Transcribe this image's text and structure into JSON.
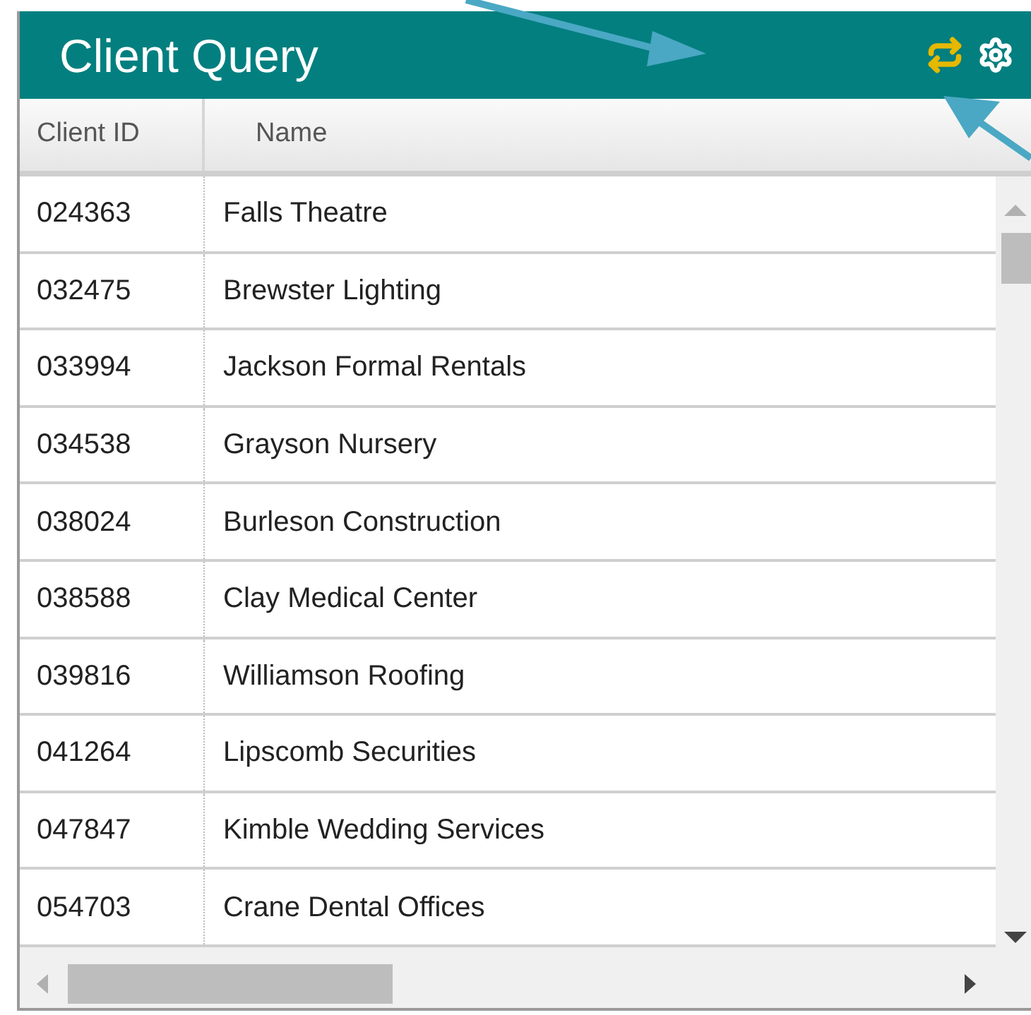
{
  "window": {
    "title": "Client Query"
  },
  "table": {
    "columns": [
      "Client ID",
      "Name"
    ],
    "rows": [
      [
        "024363",
        "Falls Theatre"
      ],
      [
        "032475",
        "Brewster Lighting"
      ],
      [
        "033994",
        "Jackson Formal Rentals"
      ],
      [
        "034538",
        "Grayson Nursery"
      ],
      [
        "038024",
        "Burleson Construction"
      ],
      [
        "038588",
        "Clay Medical Center"
      ],
      [
        "039816",
        "Williamson Roofing"
      ],
      [
        "041264",
        "Lipscomb Securities"
      ],
      [
        "047847",
        "Kimble Wedding Services"
      ],
      [
        "054703",
        "Crane Dental Offices"
      ]
    ]
  }
}
